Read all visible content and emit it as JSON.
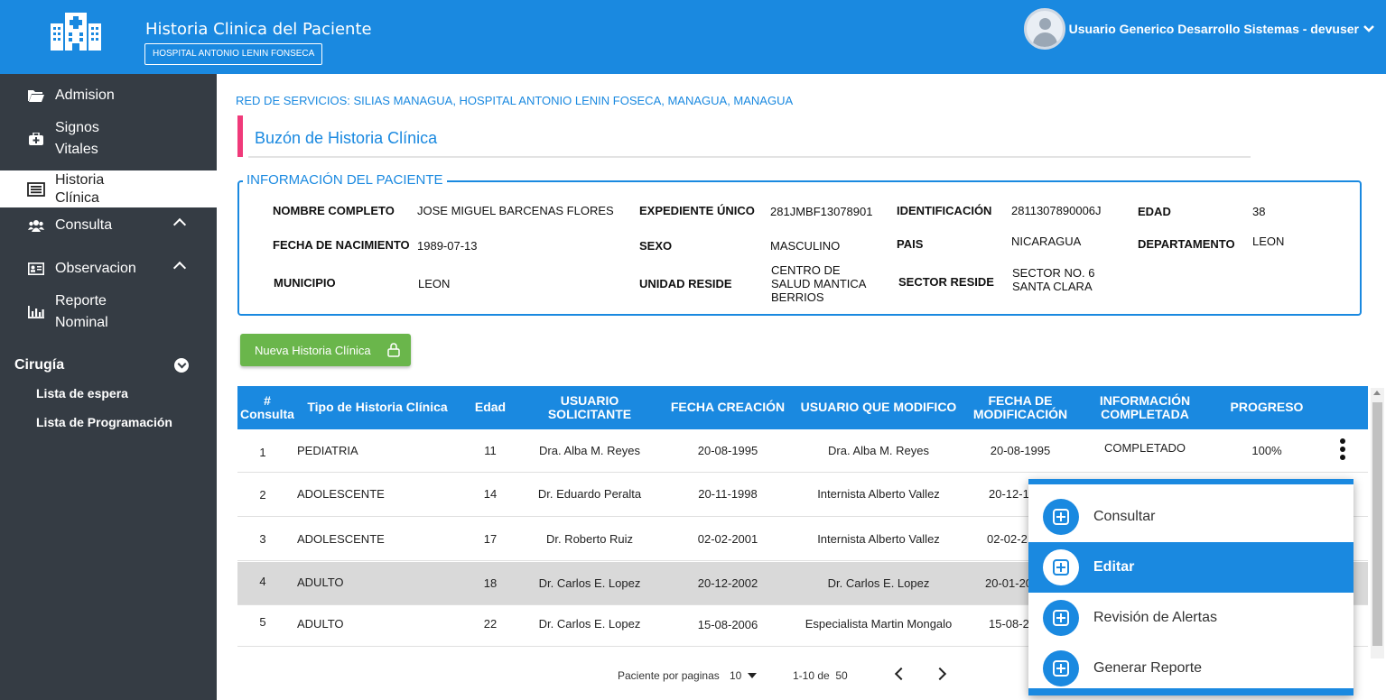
{
  "header": {
    "title": "Historia Clinica del Paciente",
    "hospital": "HOSPITAL ANTONIO LENIN FONSECA",
    "user": "Usuario Generico Desarrollo Sistemas - devuser",
    "logo_icon": "hospital-icon",
    "color": "#1a89e0"
  },
  "sidebar": {
    "items": [
      {
        "label": "Admision",
        "icon": "folder-icon"
      },
      {
        "label": "Signos",
        "label2": "Vitales",
        "icon": "medkit-icon"
      },
      {
        "label": "Historia",
        "label2": "Clínica",
        "icon": "list-icon"
      },
      {
        "label": "Consulta",
        "icon": "users-icon"
      },
      {
        "label": "Observacion",
        "icon": "id-card-icon"
      },
      {
        "label": "Reporte",
        "label2": "Nominal",
        "icon": "bar-chart-icon"
      }
    ],
    "section": "Cirugía",
    "sub_items": [
      "Lista de espera",
      "Lista de Programación"
    ]
  },
  "main": {
    "network": "RED DE SERVICIOS: SILIAS MANAGUA, HOSPITAL ANTONIO LENIN FOSECA, MANAGUA, MANAGUA",
    "title": "Buzón de Historia Clínica",
    "patient_legend": "INFORMACIÓN DEL PACIENTE",
    "patient": {
      "nombre_label": "NOMBRE COMPLETO",
      "nombre": "JOSE MIGUEL BARCENAS FLORES",
      "expediente_label": "EXPEDIENTE ÚNICO",
      "expediente": "281JMBF13078901",
      "identificacion_label": "IDENTIFICACIÓN",
      "identificacion": "2811307890006J",
      "edad_label": "EDAD",
      "edad": "38",
      "nacimiento_label": "FECHA DE NACIMIENTO",
      "nacimiento": "1989-07-13",
      "sexo_label": "SEXO",
      "sexo": "MASCULINO",
      "pais_label": "PAIS",
      "pais": "NICARAGUA",
      "departamento_label": "DEPARTAMENTO",
      "departamento": "LEON",
      "municipio_label": "MUNICIPIO",
      "municipio": "LEON",
      "unidad_label": "UNIDAD RESIDE",
      "unidad_1": "CENTRO DE",
      "unidad_2": "SALUD MANTICA",
      "unidad_3": "BERRIOS",
      "sector_label": "SECTOR RESIDE",
      "sector_1": "SECTOR NO. 6",
      "sector_2": "SANTA CLARA"
    },
    "new_button": "Nueva Historia Clínica",
    "table": {
      "headers": [
        [
          "#",
          "Consulta"
        ],
        [
          "Tipo de Historia Clínica",
          ""
        ],
        [
          "Edad",
          ""
        ],
        [
          "USUARIO",
          "SOLICITANTE"
        ],
        [
          "FECHA CREACIÓN",
          ""
        ],
        [
          "USUARIO QUE MODIFICO",
          ""
        ],
        [
          "FECHA DE",
          "MODIFICACIÓN"
        ],
        [
          "INFORMACIÓN",
          "COMPLETADA"
        ],
        [
          "PROGRESO",
          ""
        ]
      ],
      "rows": [
        [
          "1",
          "PEDIATRIA",
          "11",
          "Dra. Alba M. Reyes",
          "20-08-1995",
          "Dra. Alba M. Reyes",
          "20-08-1995",
          "COMPLETADO",
          "100%"
        ],
        [
          "2",
          "ADOLESCENTE",
          "14",
          "Dr. Eduardo Peralta",
          "20-11-1998",
          "Internista Alberto Vallez",
          "20-12-1",
          "",
          ""
        ],
        [
          "3",
          "ADOLESCENTE",
          "17",
          "Dr. Roberto Ruiz",
          "02-02-2001",
          "Internista Alberto Vallez",
          "02-02-2",
          "",
          ""
        ],
        [
          "4",
          "ADULTO",
          "18",
          "Dr. Carlos E. Lopez",
          "20-12-2002",
          "Dr. Carlos E. Lopez",
          "20-01-20",
          "",
          ""
        ],
        [
          "5",
          "ADULTO",
          "22",
          "Dr. Carlos E. Lopez",
          "15-08-2006",
          "Especialista Martin Mongalo",
          "15-08-2",
          "",
          ""
        ]
      ]
    },
    "pager": {
      "label": "Paciente por paginas",
      "size": "10",
      "range": "1-10 de",
      "total": "50"
    }
  },
  "context_menu": {
    "items": [
      "Consultar",
      "Editar",
      "Revisión de Alertas",
      "Generar Reporte"
    ],
    "selected": "Editar",
    "icon": "plus-square-icon"
  }
}
